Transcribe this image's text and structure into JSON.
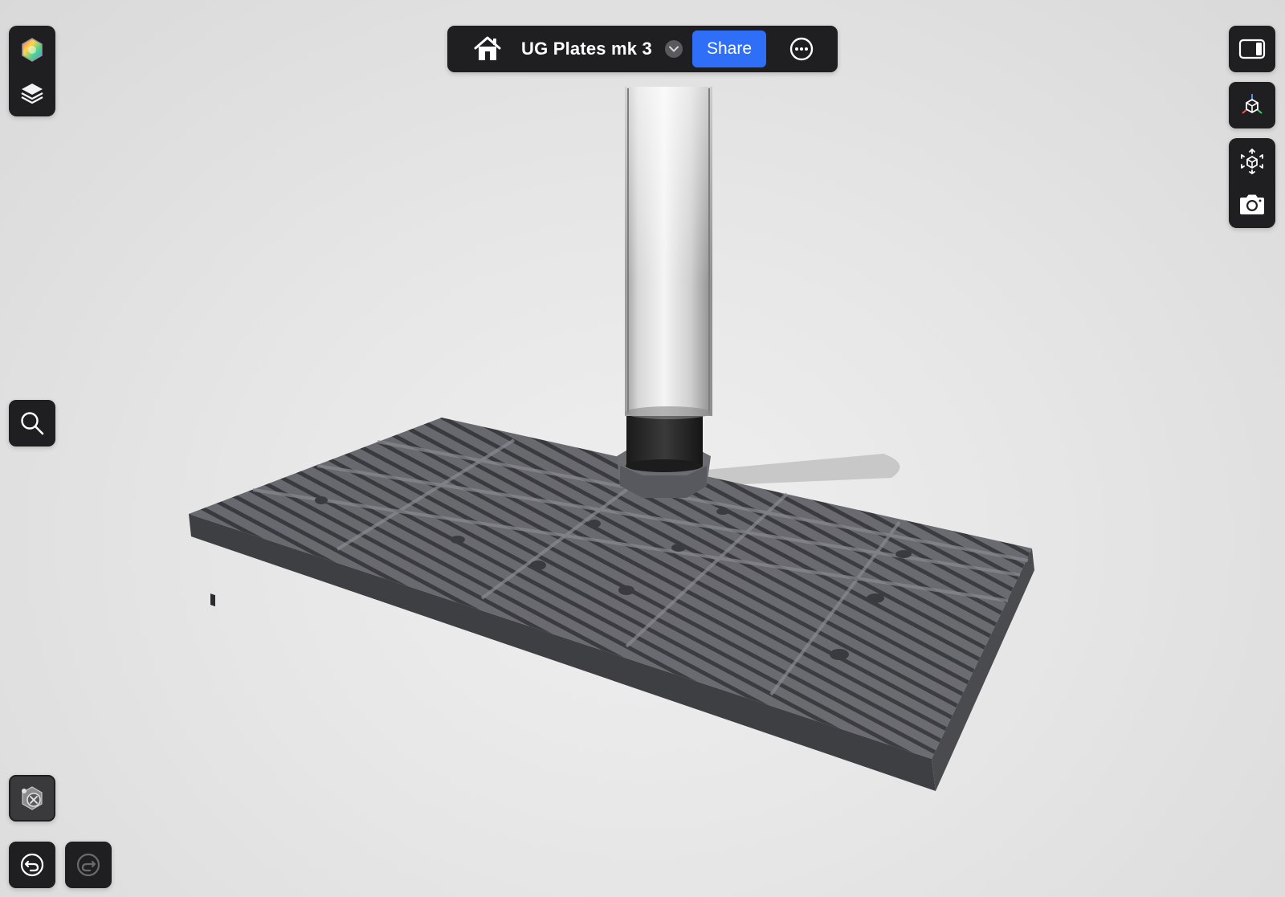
{
  "header": {
    "title": "UG Plates mk 3",
    "share_label": "Share"
  },
  "icons": {
    "home": "home-icon",
    "dropdown": "chevron-down-icon",
    "more": "more-options-icon",
    "color_wheel": "color-wheel-icon",
    "layers": "layers-icon",
    "search": "search-icon",
    "panel_toggle": "panel-toggle-icon",
    "axes": "axes-cube-icon",
    "fit_view": "fit-view-icon",
    "camera": "camera-icon",
    "hide_object": "hide-object-icon",
    "undo": "undo-icon",
    "redo": "redo-icon"
  },
  "colors": {
    "toolbar_bg": "#1f1f21",
    "accent": "#2f6ef7",
    "model_gray": "#6e6f73"
  }
}
